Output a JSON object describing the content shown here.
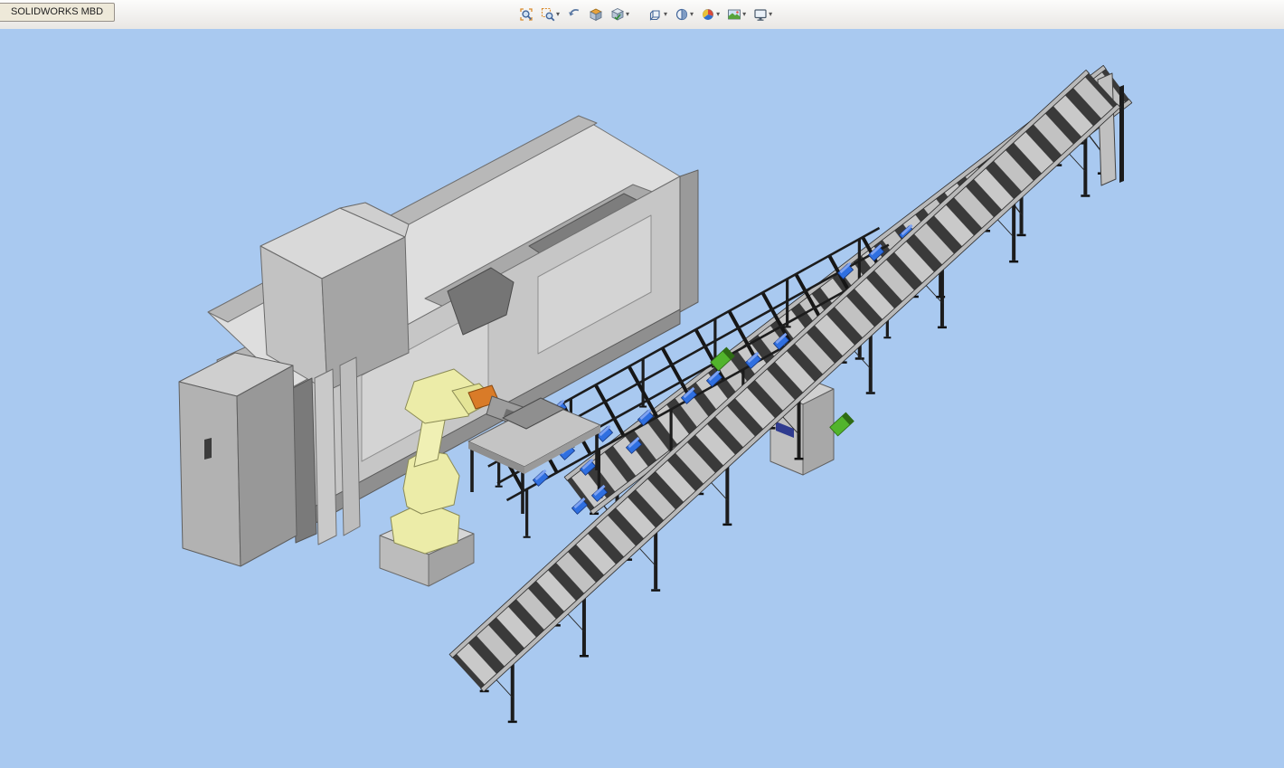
{
  "window": {
    "tab_label": "SOLIDWORKS MBD"
  },
  "toolbar": {
    "icons": [
      {
        "name": "zoom-to-fit",
        "dropdown": false
      },
      {
        "name": "zoom-to-area",
        "dropdown": true
      },
      {
        "name": "previous-view",
        "dropdown": false
      },
      {
        "name": "section-view",
        "dropdown": false
      },
      {
        "name": "dynamic-annotation-views",
        "dropdown": true
      },
      {
        "name": "view-orientation",
        "dropdown": true
      },
      {
        "name": "display-style",
        "dropdown": true
      },
      {
        "name": "edit-appearance",
        "dropdown": true
      },
      {
        "name": "apply-scene",
        "dropdown": true
      },
      {
        "name": "view-settings",
        "dropdown": true
      }
    ]
  },
  "viewport": {
    "background_color": "#a9c9f0",
    "scene": {
      "components": [
        "cnc-machine",
        "electrical-cabinet",
        "rear-conveyor",
        "control-cabinet",
        "fixture-frame",
        "blue-fixtures",
        "motors",
        "robot-arm",
        "loading-table",
        "front-conveyor"
      ],
      "colors": {
        "machine_gray": "#c6c6c6",
        "machine_top": "#dedede",
        "machine_dark": "#9a9a9a",
        "cabinet_gray": "#b2b2b2",
        "robot_yellow": "#ececa8",
        "robot_tool_orange": "#d97b28",
        "conveyor_rail": "#b9b9b9",
        "conveyor_rung": "#c9c9c9",
        "frame_black": "#1c1c1c",
        "fixture_blue": "#2f6fe0",
        "motor_green": "#52b42c"
      }
    }
  }
}
